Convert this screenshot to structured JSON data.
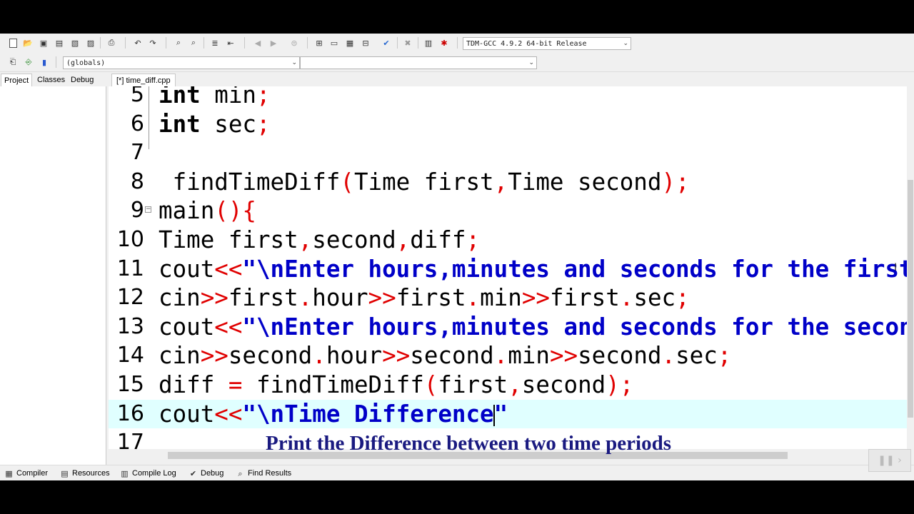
{
  "toolbar": {
    "compiler_select": "TDM-GCC 4.9.2 64-bit Release",
    "scope_select": "(globals)",
    "function_select": ""
  },
  "left_tabs": [
    "Project",
    "Classes",
    "Debug"
  ],
  "file_tab": "[*] time_diff.cpp",
  "editor": {
    "lines": [
      {
        "num": "5",
        "tokens": [
          [
            "int",
            "kw"
          ],
          [
            " min",
            ""
          ],
          [
            ";",
            "red"
          ]
        ]
      },
      {
        "num": "6",
        "tokens": [
          [
            "int",
            "kw"
          ],
          [
            " sec",
            ""
          ],
          [
            ";",
            "red"
          ]
        ]
      },
      {
        "num": "7",
        "tokens": []
      },
      {
        "num": "8",
        "tokens": [
          [
            " findTimeDiff",
            ""
          ],
          [
            "(",
            "red"
          ],
          [
            "Time first",
            ""
          ],
          [
            ",",
            "red"
          ],
          [
            "Time second",
            ""
          ],
          [
            ");",
            "red"
          ]
        ]
      },
      {
        "num": "9",
        "tokens": [
          [
            "main",
            ""
          ],
          [
            "(){",
            "red"
          ]
        ]
      },
      {
        "num": "10",
        "tokens": [
          [
            "Time first",
            ""
          ],
          [
            ",",
            "red"
          ],
          [
            "second",
            ""
          ],
          [
            ",",
            "red"
          ],
          [
            "diff",
            ""
          ],
          [
            ";",
            "red"
          ]
        ]
      },
      {
        "num": "11",
        "tokens": [
          [
            "cout",
            ""
          ],
          [
            "<<",
            "red"
          ],
          [
            "\"\\nEnter hours,minutes and seconds for the first time: \"",
            "str"
          ]
        ]
      },
      {
        "num": "12",
        "tokens": [
          [
            "cin",
            ""
          ],
          [
            ">>",
            "red"
          ],
          [
            "first",
            ""
          ],
          [
            ".",
            "red"
          ],
          [
            "hour",
            ""
          ],
          [
            ">>",
            "red"
          ],
          [
            "first",
            ""
          ],
          [
            ".",
            "red"
          ],
          [
            "min",
            ""
          ],
          [
            ">>",
            "red"
          ],
          [
            "first",
            ""
          ],
          [
            ".",
            "red"
          ],
          [
            "sec",
            ""
          ],
          [
            ";",
            "red"
          ]
        ]
      },
      {
        "num": "13",
        "tokens": [
          [
            "cout",
            ""
          ],
          [
            "<<",
            "red"
          ],
          [
            "\"\\nEnter hours,minutes and seconds for the second time: \"",
            "str"
          ]
        ]
      },
      {
        "num": "14",
        "tokens": [
          [
            "cin",
            ""
          ],
          [
            ">>",
            "red"
          ],
          [
            "second",
            ""
          ],
          [
            ".",
            "red"
          ],
          [
            "hour",
            ""
          ],
          [
            ">>",
            "red"
          ],
          [
            "second",
            ""
          ],
          [
            ".",
            "red"
          ],
          [
            "min",
            ""
          ],
          [
            ">>",
            "red"
          ],
          [
            "second",
            ""
          ],
          [
            ".",
            "red"
          ],
          [
            "sec",
            ""
          ],
          [
            ";",
            "red"
          ]
        ]
      },
      {
        "num": "15",
        "tokens": [
          [
            "diff ",
            ""
          ],
          [
            "=",
            "red"
          ],
          [
            " findTimeDiff",
            ""
          ],
          [
            "(",
            "red"
          ],
          [
            "first",
            ""
          ],
          [
            ",",
            "red"
          ],
          [
            "second",
            ""
          ],
          [
            ");",
            "red"
          ]
        ]
      },
      {
        "num": "16",
        "tokens": [
          [
            "cout",
            ""
          ],
          [
            "<<",
            "red"
          ],
          [
            "\"\\nTime Difference",
            "str"
          ],
          [
            "|caret|",
            "caret"
          ],
          [
            "\"",
            "str"
          ]
        ]
      },
      {
        "num": "17",
        "tokens": []
      }
    ]
  },
  "caption": "Print the Difference between two time periods",
  "bottom_tabs": [
    {
      "label": "Compiler",
      "icon": "compiler-grid-icon"
    },
    {
      "label": "Resources",
      "icon": "resources-icon"
    },
    {
      "label": "Compile Log",
      "icon": "compile-log-chart-icon"
    },
    {
      "label": "Debug",
      "icon": "debug-check-icon"
    },
    {
      "label": "Find Results",
      "icon": "find-results-icon"
    }
  ]
}
